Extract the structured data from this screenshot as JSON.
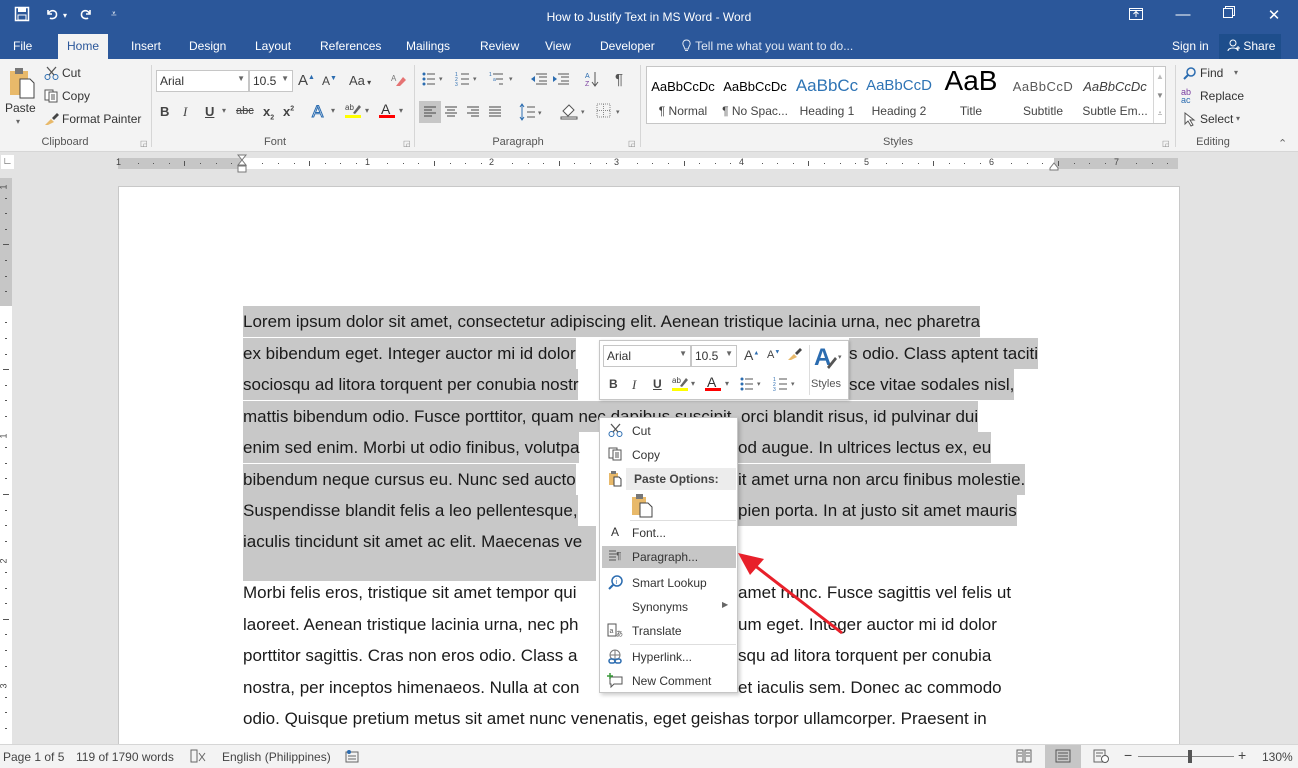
{
  "window": {
    "title": "How to Justify Text in MS Word - Word",
    "qat": {
      "save": "save-icon",
      "undo": "undo-icon",
      "redo": "redo-icon",
      "customize": "customize-qat-icon"
    },
    "controls": {
      "ribbon_options": "ribbon-display-options-icon",
      "minimize": "—",
      "restore": "❐",
      "close": "✕"
    }
  },
  "tabs": [
    "File",
    "Home",
    "Insert",
    "Design",
    "Layout",
    "References",
    "Mailings",
    "Review",
    "View",
    "Developer"
  ],
  "active_tab": "Home",
  "tell_me": "Tell me what you want to do...",
  "sign_in": "Sign in",
  "share": "Share",
  "ribbon": {
    "clipboard": {
      "label": "Clipboard",
      "paste": "Paste",
      "cut": "Cut",
      "copy": "Copy",
      "format_painter": "Format Painter"
    },
    "font": {
      "label": "Font",
      "font_name": "Arial",
      "font_size": "10.5",
      "change_case": "Aa"
    },
    "paragraph": {
      "label": "Paragraph",
      "active_alignment": "align-left"
    },
    "styles": {
      "label": "Styles",
      "items": [
        {
          "preview": "AaBbCcDc",
          "name": "¶ Normal",
          "color": "#000000"
        },
        {
          "preview": "AaBbCcDc",
          "name": "¶ No Spac...",
          "color": "#000000"
        },
        {
          "preview": "AaBbCc",
          "name": "Heading 1",
          "color": "#2e74b5"
        },
        {
          "preview": "AaBbCcD",
          "name": "Heading 2",
          "color": "#2e74b5"
        },
        {
          "preview": "AaB",
          "name": "Title",
          "color": "#000000"
        },
        {
          "preview": "AaBbCcD",
          "name": "Subtitle",
          "color": "#595959"
        },
        {
          "preview": "AaBbCcDc",
          "name": "Subtle Em...",
          "color": "#404040"
        }
      ]
    },
    "editing": {
      "label": "Editing",
      "find": "Find",
      "replace": "Replace",
      "select": "Select"
    }
  },
  "ruler": {
    "h_labels": [
      "1",
      "1",
      "2",
      "3",
      "4",
      "5",
      "6",
      "7"
    ],
    "v_labels": [
      "1",
      "1",
      "2",
      "3"
    ]
  },
  "document": {
    "selected_lines": [
      "Lorem ipsum dolor sit amet, consectetur adipiscing elit. Aenean tristique lacinia urna, nec pharetra",
      "ex bibendum eget. Integer auctor mi id dolor",
      "sociosqu ad litora torquent per conubia nostr",
      "mattis bibendum odio. Fusce porttitor, quam nec dapibus suscipit, orci blandit risus, id pulvinar dui",
      "enim sed enim. Morbi ut odio finibus, volutpa",
      "bibendum neque cursus eu. Nunc sed aucto",
      "Suspendisse blandit felis a leo pellentesque,",
      "iaculis tincidunt sit amet ac elit. Maecenas ve"
    ],
    "selected_lines_right": [
      "",
      "s odio. Class aptent taciti",
      "sce vitae sodales nisl,",
      "",
      "od augue. In ultrices lectus ex, eu",
      "it amet urna non arcu finibus molestie.",
      "pien porta. In at justo sit amet mauris",
      ""
    ],
    "normal_lines": [
      "Morbi felis eros, tristique sit amet tempor qui",
      "laoreet. Aenean tristique lacinia urna, nec ph",
      "porttitor sagittis. Cras non eros odio. Class a",
      "nostra, per inceptos himenaeos. Nulla at con",
      "odio. Quisque pretium metus sit amet nunc venenatis, eget geishas torpor ullamcorper. Praesent in"
    ],
    "normal_lines_right": [
      "amet nunc. Fusce sagittis vel felis ut",
      "um eget. Integer auctor mi id dolor",
      "squ ad litora torquent per conubia",
      "et iaculis sem. Donec ac commodo",
      ""
    ]
  },
  "mini_toolbar": {
    "font_name": "Arial",
    "font_size": "10.5",
    "styles_label": "Styles"
  },
  "context_menu": {
    "items": [
      {
        "label": "Cut",
        "icon": "scissors-icon"
      },
      {
        "label": "Copy",
        "icon": "copy-icon"
      },
      {
        "label": "Paste Options:",
        "icon": "paste-icon",
        "header": true
      },
      {
        "label": "Font...",
        "icon": "font-icon"
      },
      {
        "label": "Paragraph...",
        "icon": "paragraph-icon",
        "highlighted": true
      },
      {
        "label": "Smart Lookup",
        "icon": "smart-lookup-icon"
      },
      {
        "label": "Synonyms",
        "icon": "",
        "submenu": true
      },
      {
        "label": "Translate",
        "icon": "translate-icon"
      },
      {
        "label": "Hyperlink...",
        "icon": "hyperlink-icon"
      },
      {
        "label": "New Comment",
        "icon": "new-comment-icon"
      }
    ]
  },
  "annotation": {
    "arrow_color": "#e8202a",
    "points_to": "Paragraph..."
  },
  "status_bar": {
    "page": "Page 1 of 5",
    "words": "119 of 1790 words",
    "language": "English (Philippines)",
    "zoom": "130%",
    "zoom_level_percent": 130
  },
  "colors": {
    "brand": "#2b579a",
    "highlight": "#ffff00",
    "font_color": "#ff0000",
    "selection": "#c8c8c8"
  }
}
